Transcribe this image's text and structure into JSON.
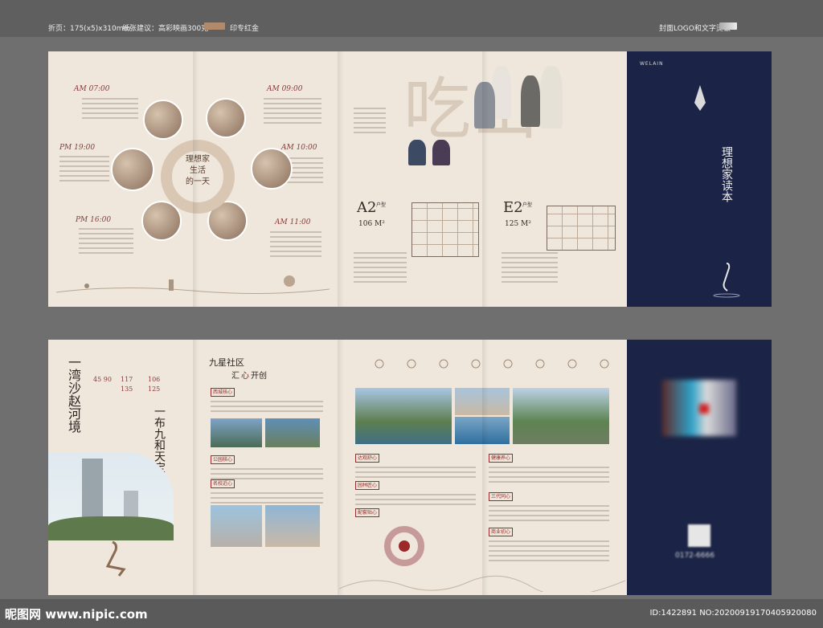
{
  "topbar": {
    "folded_size": "折页：175(x5)x310mm",
    "paper_note": "纸张建议：高彩映画300克",
    "gold_note": "印专红金",
    "cover_note": "封面LOGO和文字烫银",
    "colors": {
      "gold": "#b08a6a",
      "silver": "#c9c9c9"
    }
  },
  "top_sheet": {
    "schedule": [
      {
        "time": "AM 07:00"
      },
      {
        "time": "AM 09:00"
      },
      {
        "time": "AM 10:00"
      },
      {
        "time": "AM 11:00"
      },
      {
        "time": "PM 16:00"
      },
      {
        "time": "PM 19:00"
      }
    ],
    "ring_title": "理想家\n生活\n的一天",
    "big_chars": "吃山",
    "unit_a": {
      "name": "A2",
      "suffix": "户型",
      "area": "106 M²"
    },
    "unit_e": {
      "name": "E2",
      "suffix": "户型",
      "area": "125 M²"
    },
    "cover": {
      "brand": "WELAIN",
      "slogan": "理想家读本",
      "colors": {
        "navy": "#1b2446"
      }
    }
  },
  "bottom_sheet": {
    "vertical_left": "一湾沙赵河境",
    "vertical_right": "一布九和天宝",
    "stats": [
      "45 90",
      "117 135",
      "106 125"
    ],
    "section_title": "九星社区",
    "section_sub_1": "汇",
    "section_sub_2": "心",
    "section_sub_3": "开创",
    "tags_left": [
      "西城核心",
      "公园核心",
      "名校近心"
    ],
    "tags_mid": [
      "达观舒心",
      "园林匠心",
      "配套贴心"
    ],
    "tags_right": [
      "健康养心",
      "三代同心",
      "商业初心"
    ],
    "phone": "0172-6666"
  },
  "watermark": {
    "site": "昵图网 www.nipic.com",
    "id": "ID:1422891 NO:20200919170405920080"
  }
}
